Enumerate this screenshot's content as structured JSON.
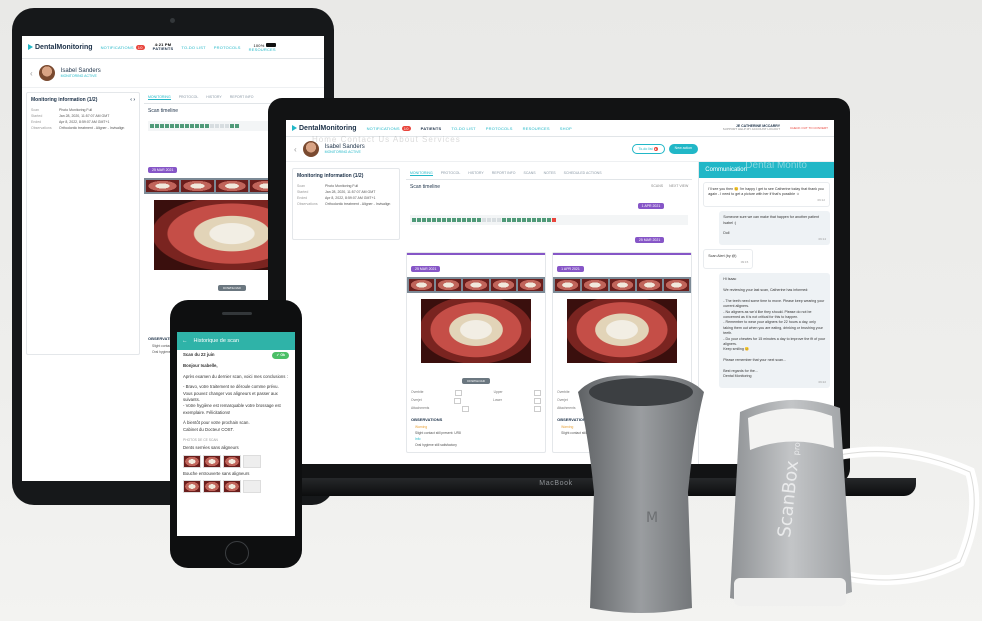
{
  "brand": {
    "name": "DentalMonitoring",
    "accent": "#21b7c7",
    "purple": "#8656c7"
  },
  "nav": {
    "notifications": "NOTIFICATIONS",
    "notif_count": "10",
    "patients": "PATIENTS",
    "todo": "TO-DO LIST",
    "protocols": "PROTOCOLS",
    "resources": "RESOURCES",
    "shop": "SHOP",
    "tablet_time": "4:21 PM",
    "battery": "100%",
    "user": "JE CATHERINE MCCARRY",
    "user_links": "SUPPORT   HELP   MY ACCOUNT   LOGOUT",
    "switch": "CHECK OUT TO CONVERT"
  },
  "patient": {
    "name": "Isabel Sanders",
    "sub": "MONITORING ACTIVE"
  },
  "monitoring": {
    "title": "Monitoring information (1/2)",
    "rows": [
      {
        "label": "Scan",
        "value": "Photo Monitoring Full"
      },
      {
        "label": "Started",
        "value": "Jan 28, 2020, 11:57:07 AM GMT"
      },
      {
        "label": "Ended",
        "value": "Apr 8, 2022, 8:59:07 AM GMT+1"
      },
      {
        "label": "Observations",
        "value": "Orthodontic treatment - Aligner - Invisalign"
      }
    ]
  },
  "tabs": [
    "MONITORING",
    "PROTOCOL",
    "HISTORY",
    "REPORT INFO",
    "SCANS",
    "NOTES",
    "SCHEDULED ACTIONS"
  ],
  "tablet_tabs": [
    "MONITORING",
    "PROTOCOL",
    "HISTORY",
    "REPORT INFO"
  ],
  "scan_timeline": {
    "title": "Scan timeline",
    "controls": "SCANS",
    "next": "NEXT VIEW"
  },
  "scans": [
    {
      "date": "25 MAR 2021",
      "button": "DOWNLOAD"
    },
    {
      "date": "1 APR 2021",
      "button": "DOWNLOAD"
    }
  ],
  "tablet_scan_date": "25 MAR 2021",
  "table": {
    "rows": [
      "Overbite",
      "Overjet",
      "Attachments"
    ],
    "cols": [
      "Upper",
      "Lower"
    ]
  },
  "observations": {
    "title": "OBSERVATIONS",
    "items": [
      "Warning",
      "Slight contact still present: UR8",
      "Info",
      "Oral hygiene still satisfactory"
    ]
  },
  "actions": {
    "todo": "To-do list",
    "new": "New action"
  },
  "chat": {
    "title": "Communication",
    "messages": [
      {
        "text": "I'll see you then 😊 I'm happy I get to see Catherine today that thank you again - I need to get a picture with her if that's possible ☺",
        "meta": "09:12"
      },
      {
        "text": "Someone sure we can make that happen for another patient Isabel :)\n\nDoll",
        "meta": "09:14"
      },
      {
        "text": "Scan Alert (by @)",
        "meta": "09:15"
      },
      {
        "text": "Hi Isaac\n\nWe reviewing your last scan, Catherine has informed:\n\n- The teeth need some time to move. Please keep wearing your current aligners.\n- No aligners as we'd like they should. Please do not be concerned as it is not critical for this to happen.\n- Remember to wear your aligners for 22 hours a day, only taking them out when you are eating, drinking or brushing your teeth.\n- Do your chewies for 15 minutes a day to improve the fit of your aligners.\nKeep smiling 😊\n\nPlease remember that your next scan...\n\nBest regards for the...\nDental Monitoring",
        "meta": "09:22"
      }
    ]
  },
  "phone": {
    "title": "Historique de scan",
    "scan_title": "Scan du 22 juin",
    "ok_label": "Ok",
    "paragraphs": [
      "Bonjour Isabelle,",
      "Après examen du dernier scan, voici mes conclusions :",
      "- Bravo, votre traitement se déroule comme prévu. Vous pouvez changer vos aligneurs et passer aux suivants.\n- Votre hygiène est remarquable votre brossage est exemplaire. Félicitations!",
      "À bientôt pour votre prochain scan.\nCabinet du Docteur COST."
    ],
    "section_label": "PHOTOS DE CE SCAN",
    "groups": [
      "Dents serrées sans aligneurs",
      "Bouche entrouverte sans aligneurs"
    ]
  },
  "laptop_brand": "MacBook",
  "devices": {
    "scanbox_label": "ScanBox",
    "scanbox_sub": "pro",
    "cheek_logo": "M"
  },
  "overlay_text": {
    "tabs_ghost": "Home   Contact Us   About   Services",
    "chat_ghost": "Dental Monito"
  }
}
